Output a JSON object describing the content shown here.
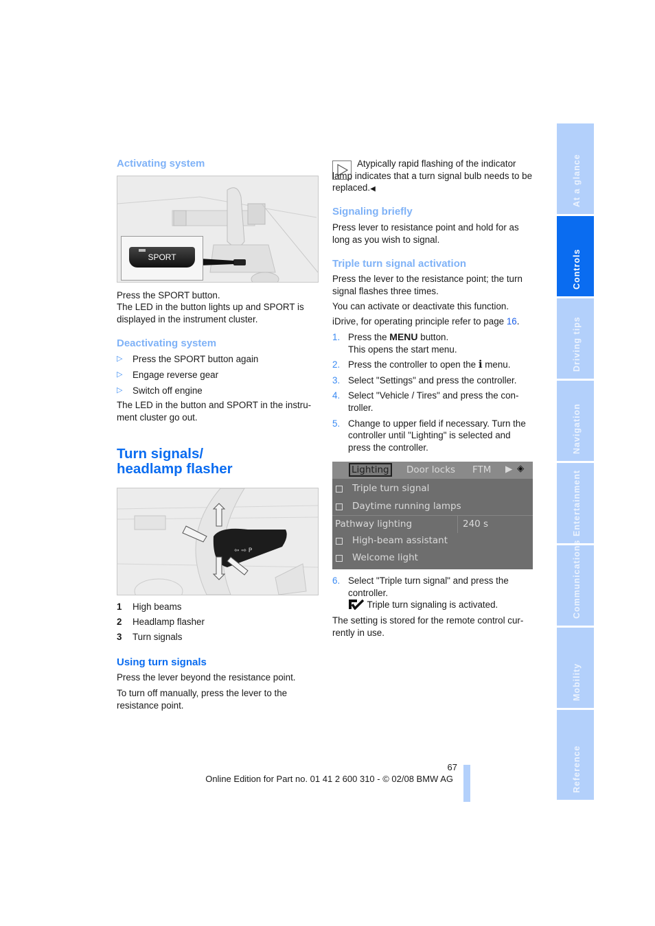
{
  "left": {
    "activating": {
      "heading": "Activating system",
      "figure_label": "SPORT",
      "line1": "Press the SPORT button.",
      "line2": "The LED in the button lights up and SPORT is displayed in the instrument cluster."
    },
    "deactivating": {
      "heading": "Deactivating system",
      "items": [
        "Press the SPORT button again",
        "Engage reverse gear",
        "Switch off engine"
      ],
      "after": "The LED in the button and SPORT in the instru-ment cluster go out."
    },
    "section_title_line1": "Turn signals/",
    "section_title_line2": "headlamp flasher",
    "legend": [
      {
        "num": "1",
        "text": "High beams"
      },
      {
        "num": "2",
        "text": "Headlamp flasher"
      },
      {
        "num": "3",
        "text": "Turn signals"
      }
    ],
    "using": {
      "heading": "Using turn signals",
      "p1": "Press the lever beyond the resistance point.",
      "p2": "To turn off manually, press the lever to the resistance point."
    }
  },
  "right": {
    "note": "Atypically rapid flashing of the indicator lamp indicates that a turn signal bulb needs to be replaced.",
    "note_end": "◀",
    "briefly": {
      "heading": "Signaling briefly",
      "text": "Press lever to resistance point and hold for as long as you wish to signal."
    },
    "triple": {
      "heading": "Triple turn signal activation",
      "p1": "Press the lever to the resistance point; the turn signal flashes three times.",
      "p2": "You can activate or deactivate this function.",
      "p3_prefix": "iDrive, for operating principle refer to page ",
      "p3_link": "16",
      "p3_suffix": ".",
      "steps": [
        {
          "num": "1.",
          "pre": "Press the ",
          "bold": "MENU",
          "post": " button.",
          "sub": "This opens the start menu."
        },
        {
          "num": "2.",
          "pre": "Press the controller to open the ",
          "icon": "i",
          "post": " menu."
        },
        {
          "num": "3.",
          "text": "Select \"Settings\" and press the controller."
        },
        {
          "num": "4.",
          "text": "Select \"Vehicle / Tires\" and press the con-troller."
        },
        {
          "num": "5.",
          "text": "Change to upper field if necessary. Turn the controller until \"Lighting\" is selected and press the controller."
        }
      ],
      "step6": {
        "num": "6.",
        "text": "Select \"Triple turn signal\" and press the controller.",
        "result": "Triple turn signaling is activated."
      },
      "footer": "The setting is stored for the remote control cur-rently in use."
    },
    "idrive": {
      "tabs": [
        "Lighting",
        "Door locks",
        "FTM"
      ],
      "rows": [
        {
          "label": "Triple turn signal",
          "checkbox": true
        },
        {
          "label": "Daytime running lamps",
          "checkbox": true
        },
        {
          "label": "Pathway lighting",
          "checkbox": false,
          "value": "240 s"
        },
        {
          "label": "High-beam assistant",
          "checkbox": true
        },
        {
          "label": "Welcome light",
          "checkbox": true
        }
      ]
    }
  },
  "sidebar": {
    "tabs": [
      {
        "label": "At a glance",
        "active": false
      },
      {
        "label": "Controls",
        "active": true
      },
      {
        "label": "Driving tips",
        "active": false
      },
      {
        "label": "Navigation",
        "active": false
      },
      {
        "label": "Entertainment",
        "active": false
      },
      {
        "label": "Communications",
        "active": false
      },
      {
        "label": "Mobility",
        "active": false
      },
      {
        "label": "Reference",
        "active": false
      }
    ]
  },
  "footer": {
    "page_number": "67",
    "edition": "Online Edition for Part no. 01 41 2 600 310 - © 02/08 BMW AG"
  },
  "colors": {
    "accent": "#0a6cf0",
    "accent_light": "#7fb2f7",
    "sidebar_tab": "#b3d0fb"
  }
}
